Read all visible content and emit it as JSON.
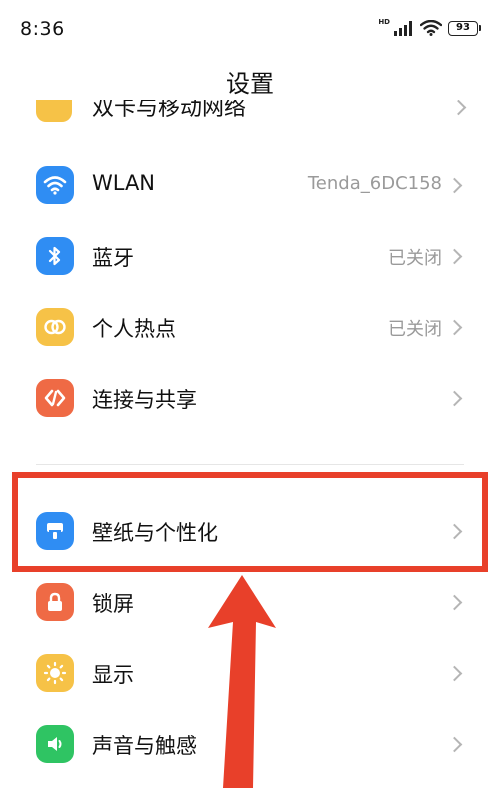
{
  "status_bar": {
    "time": "8:36",
    "network_badge": "HD",
    "battery": "93"
  },
  "header": {
    "title": "设置"
  },
  "partial_row": {
    "label": "双卡与移动网络",
    "icon": "sim-card-icon"
  },
  "rows": [
    {
      "label": "WLAN",
      "value": "Tenda_6DC158",
      "icon": "wifi-icon",
      "icon_color": "#2f8df3"
    },
    {
      "label": "蓝牙",
      "value": "已关闭",
      "icon": "bluetooth-icon",
      "icon_color": "#2f8df3"
    },
    {
      "label": "个人热点",
      "value": "已关闭",
      "icon": "hotspot-icon",
      "icon_color": "#f6c247"
    },
    {
      "label": "连接与共享",
      "value": "",
      "icon": "share-icon",
      "icon_color": "#ef6a45"
    },
    {
      "label": "壁纸与个性化",
      "value": "",
      "icon": "wallpaper-icon",
      "icon_color": "#2f8df3"
    },
    {
      "label": "锁屏",
      "value": "",
      "icon": "lock-icon",
      "icon_color": "#ef6a45"
    },
    {
      "label": "显示",
      "value": "",
      "icon": "sun-icon",
      "icon_color": "#f6c247"
    },
    {
      "label": "声音与触感",
      "value": "",
      "icon": "speaker-icon",
      "icon_color": "#2fc463"
    }
  ],
  "annotation": {
    "highlight_color": "#e8402a"
  }
}
